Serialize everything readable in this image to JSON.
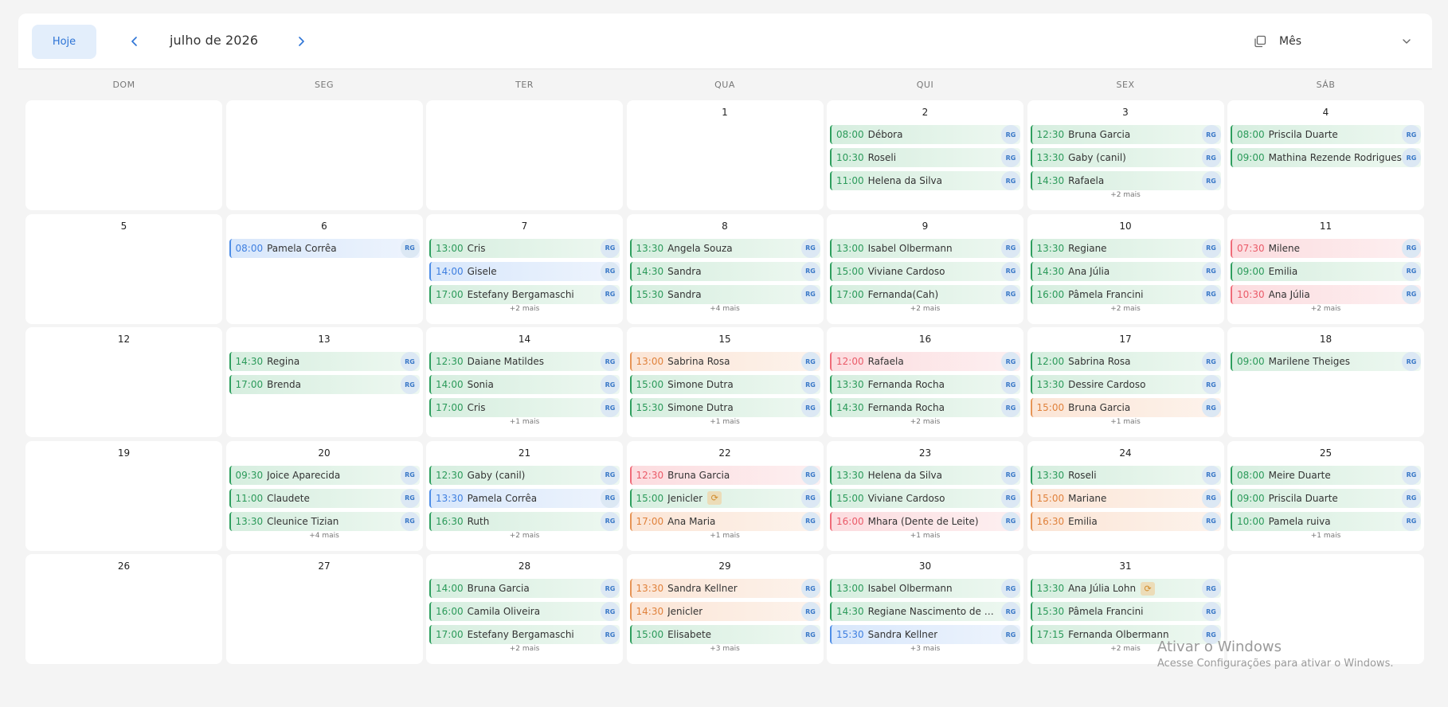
{
  "header": {
    "today_label": "Hoje",
    "month_title": "julho de 2026",
    "view_label": "Mês"
  },
  "weekdays": [
    "DOM",
    "SEG",
    "TER",
    "QUA",
    "QUI",
    "SEX",
    "SÁB"
  ],
  "badge_label": "RG",
  "category_colors": {
    "green": "#2e9e5e",
    "blue": "#4d8de6",
    "red": "#ef6b78",
    "orange": "#e69456"
  },
  "weeks": [
    [
      {
        "day": "",
        "events": []
      },
      {
        "day": "",
        "events": []
      },
      {
        "day": "",
        "events": []
      },
      {
        "day": "1",
        "events": []
      },
      {
        "day": "2",
        "events": [
          {
            "time": "08:00",
            "name": "Débora",
            "color": "green"
          },
          {
            "time": "10:30",
            "name": "Roseli",
            "color": "green"
          },
          {
            "time": "11:00",
            "name": "Helena da Silva",
            "color": "green"
          }
        ]
      },
      {
        "day": "3",
        "events": [
          {
            "time": "12:30",
            "name": "Bruna Garcia",
            "color": "green"
          },
          {
            "time": "13:30",
            "name": "Gaby (canil)",
            "color": "green"
          },
          {
            "time": "14:30",
            "name": "Rafaela",
            "color": "green"
          }
        ],
        "more": "+2 mais"
      },
      {
        "day": "4",
        "events": [
          {
            "time": "08:00",
            "name": "Priscila Duarte",
            "color": "green"
          },
          {
            "time": "09:00",
            "name": "Mathina Rezende Rodrigues",
            "color": "green"
          }
        ]
      }
    ],
    [
      {
        "day": "5",
        "events": []
      },
      {
        "day": "6",
        "events": [
          {
            "time": "08:00",
            "name": "Pamela Corrêa",
            "color": "blue"
          }
        ]
      },
      {
        "day": "7",
        "events": [
          {
            "time": "13:00",
            "name": "Cris",
            "color": "green"
          },
          {
            "time": "14:00",
            "name": "Gisele",
            "color": "blue"
          },
          {
            "time": "17:00",
            "name": "Estefany Bergamaschi",
            "color": "green"
          }
        ],
        "more": "+2 mais"
      },
      {
        "day": "8",
        "events": [
          {
            "time": "13:30",
            "name": "Angela Souza",
            "color": "green"
          },
          {
            "time": "14:30",
            "name": "Sandra",
            "color": "green"
          },
          {
            "time": "15:30",
            "name": "Sandra",
            "color": "green"
          }
        ],
        "more": "+4 mais"
      },
      {
        "day": "9",
        "events": [
          {
            "time": "13:00",
            "name": "Isabel Olbermann",
            "color": "green"
          },
          {
            "time": "15:00",
            "name": "Viviane Cardoso",
            "color": "green"
          },
          {
            "time": "17:00",
            "name": "Fernanda(Cah)",
            "color": "green"
          }
        ],
        "more": "+2 mais"
      },
      {
        "day": "10",
        "events": [
          {
            "time": "13:30",
            "name": "Regiane",
            "color": "green"
          },
          {
            "time": "14:30",
            "name": "Ana Júlia",
            "color": "green"
          },
          {
            "time": "16:00",
            "name": "Pâmela Francini",
            "color": "green"
          }
        ],
        "more": "+2 mais"
      },
      {
        "day": "11",
        "events": [
          {
            "time": "07:30",
            "name": "Milene",
            "color": "red"
          },
          {
            "time": "09:00",
            "name": "Emilia",
            "color": "green"
          },
          {
            "time": "10:30",
            "name": "Ana Júlia",
            "color": "red"
          }
        ],
        "more": "+2 mais"
      }
    ],
    [
      {
        "day": "12",
        "events": []
      },
      {
        "day": "13",
        "events": [
          {
            "time": "14:30",
            "name": "Regina",
            "color": "green"
          },
          {
            "time": "17:00",
            "name": "Brenda",
            "color": "green"
          }
        ]
      },
      {
        "day": "14",
        "events": [
          {
            "time": "12:30",
            "name": "Daiane Matildes",
            "color": "green"
          },
          {
            "time": "14:00",
            "name": "Sonia",
            "color": "green"
          },
          {
            "time": "17:00",
            "name": "Cris",
            "color": "green"
          }
        ],
        "more": "+1 mais"
      },
      {
        "day": "15",
        "events": [
          {
            "time": "13:00",
            "name": "Sabrina Rosa",
            "color": "orange"
          },
          {
            "time": "15:00",
            "name": "Simone Dutra",
            "color": "green"
          },
          {
            "time": "15:30",
            "name": "Simone Dutra",
            "color": "green"
          }
        ],
        "more": "+1 mais"
      },
      {
        "day": "16",
        "events": [
          {
            "time": "12:00",
            "name": "Rafaela",
            "color": "red"
          },
          {
            "time": "13:30",
            "name": "Fernanda Rocha",
            "color": "green"
          },
          {
            "time": "14:30",
            "name": "Fernanda Rocha",
            "color": "green"
          }
        ],
        "more": "+2 mais"
      },
      {
        "day": "17",
        "events": [
          {
            "time": "12:00",
            "name": "Sabrina Rosa",
            "color": "green"
          },
          {
            "time": "13:30",
            "name": "Dessire Cardoso",
            "color": "green"
          },
          {
            "time": "15:00",
            "name": "Bruna Garcia",
            "color": "orange"
          }
        ],
        "more": "+1 mais"
      },
      {
        "day": "18",
        "events": [
          {
            "time": "09:00",
            "name": "Marilene Theiges",
            "color": "green"
          }
        ]
      }
    ],
    [
      {
        "day": "19",
        "events": []
      },
      {
        "day": "20",
        "events": [
          {
            "time": "09:30",
            "name": "Joice Aparecida",
            "color": "green"
          },
          {
            "time": "11:00",
            "name": "Claudete",
            "color": "green"
          },
          {
            "time": "13:30",
            "name": "Cleunice Tizian",
            "color": "green"
          }
        ],
        "more": "+4 mais"
      },
      {
        "day": "21",
        "events": [
          {
            "time": "12:30",
            "name": "Gaby (canil)",
            "color": "green"
          },
          {
            "time": "13:30",
            "name": "Pamela Corrêa",
            "color": "blue"
          },
          {
            "time": "16:30",
            "name": "Ruth",
            "color": "green"
          }
        ],
        "more": "+2 mais"
      },
      {
        "day": "22",
        "events": [
          {
            "time": "12:30",
            "name": "Bruna Garcia",
            "color": "red"
          },
          {
            "time": "15:00",
            "name": "Jenicler",
            "color": "green",
            "badge": "⟳"
          },
          {
            "time": "17:00",
            "name": "Ana Maria",
            "color": "orange"
          }
        ],
        "more": "+1 mais"
      },
      {
        "day": "23",
        "events": [
          {
            "time": "13:30",
            "name": "Helena da Silva",
            "color": "green"
          },
          {
            "time": "15:00",
            "name": "Viviane Cardoso",
            "color": "green"
          },
          {
            "time": "16:00",
            "name": "Mhara (Dente de Leite)",
            "color": "red"
          }
        ],
        "more": "+1 mais"
      },
      {
        "day": "24",
        "events": [
          {
            "time": "13:30",
            "name": "Roseli",
            "color": "green"
          },
          {
            "time": "15:00",
            "name": "Mariane",
            "color": "orange"
          },
          {
            "time": "16:30",
            "name": "Emilia",
            "color": "orange"
          }
        ]
      },
      {
        "day": "25",
        "events": [
          {
            "time": "08:00",
            "name": "Meire Duarte",
            "color": "green"
          },
          {
            "time": "09:00",
            "name": "Priscila Duarte",
            "color": "green"
          },
          {
            "time": "10:00",
            "name": "Pamela ruiva",
            "color": "green"
          }
        ],
        "more": "+1 mais"
      }
    ],
    [
      {
        "day": "26",
        "events": []
      },
      {
        "day": "27",
        "events": []
      },
      {
        "day": "28",
        "events": [
          {
            "time": "14:00",
            "name": "Bruna Garcia",
            "color": "green"
          },
          {
            "time": "16:00",
            "name": "Camila Oliveira",
            "color": "green"
          },
          {
            "time": "17:00",
            "name": "Estefany Bergamaschi",
            "color": "green"
          }
        ],
        "more": "+2 mais"
      },
      {
        "day": "29",
        "events": [
          {
            "time": "13:30",
            "name": "Sandra Kellner",
            "color": "orange"
          },
          {
            "time": "14:30",
            "name": "Jenicler",
            "color": "orange"
          },
          {
            "time": "15:00",
            "name": "Elisabete",
            "color": "green"
          }
        ],
        "more": "+3 mais"
      },
      {
        "day": "30",
        "events": [
          {
            "time": "13:00",
            "name": "Isabel Olbermann",
            "color": "green"
          },
          {
            "time": "14:30",
            "name": "Regiane Nascimento de Oliveira",
            "color": "green"
          },
          {
            "time": "15:30",
            "name": "Sandra Kellner",
            "color": "blue"
          }
        ],
        "more": "+3 mais"
      },
      {
        "day": "31",
        "events": [
          {
            "time": "13:30",
            "name": "Ana Júlia Lohn",
            "color": "green",
            "badge": "⟳"
          },
          {
            "time": "15:30",
            "name": "Pâmela Francini",
            "color": "green"
          },
          {
            "time": "17:15",
            "name": "Fernanda Olbermann",
            "color": "green"
          }
        ],
        "more": "+2 mais"
      },
      {
        "day": "",
        "events": []
      }
    ]
  ],
  "watermark": {
    "line1": "Ativar o Windows",
    "line2": "Acesse Configurações para ativar o Windows."
  }
}
